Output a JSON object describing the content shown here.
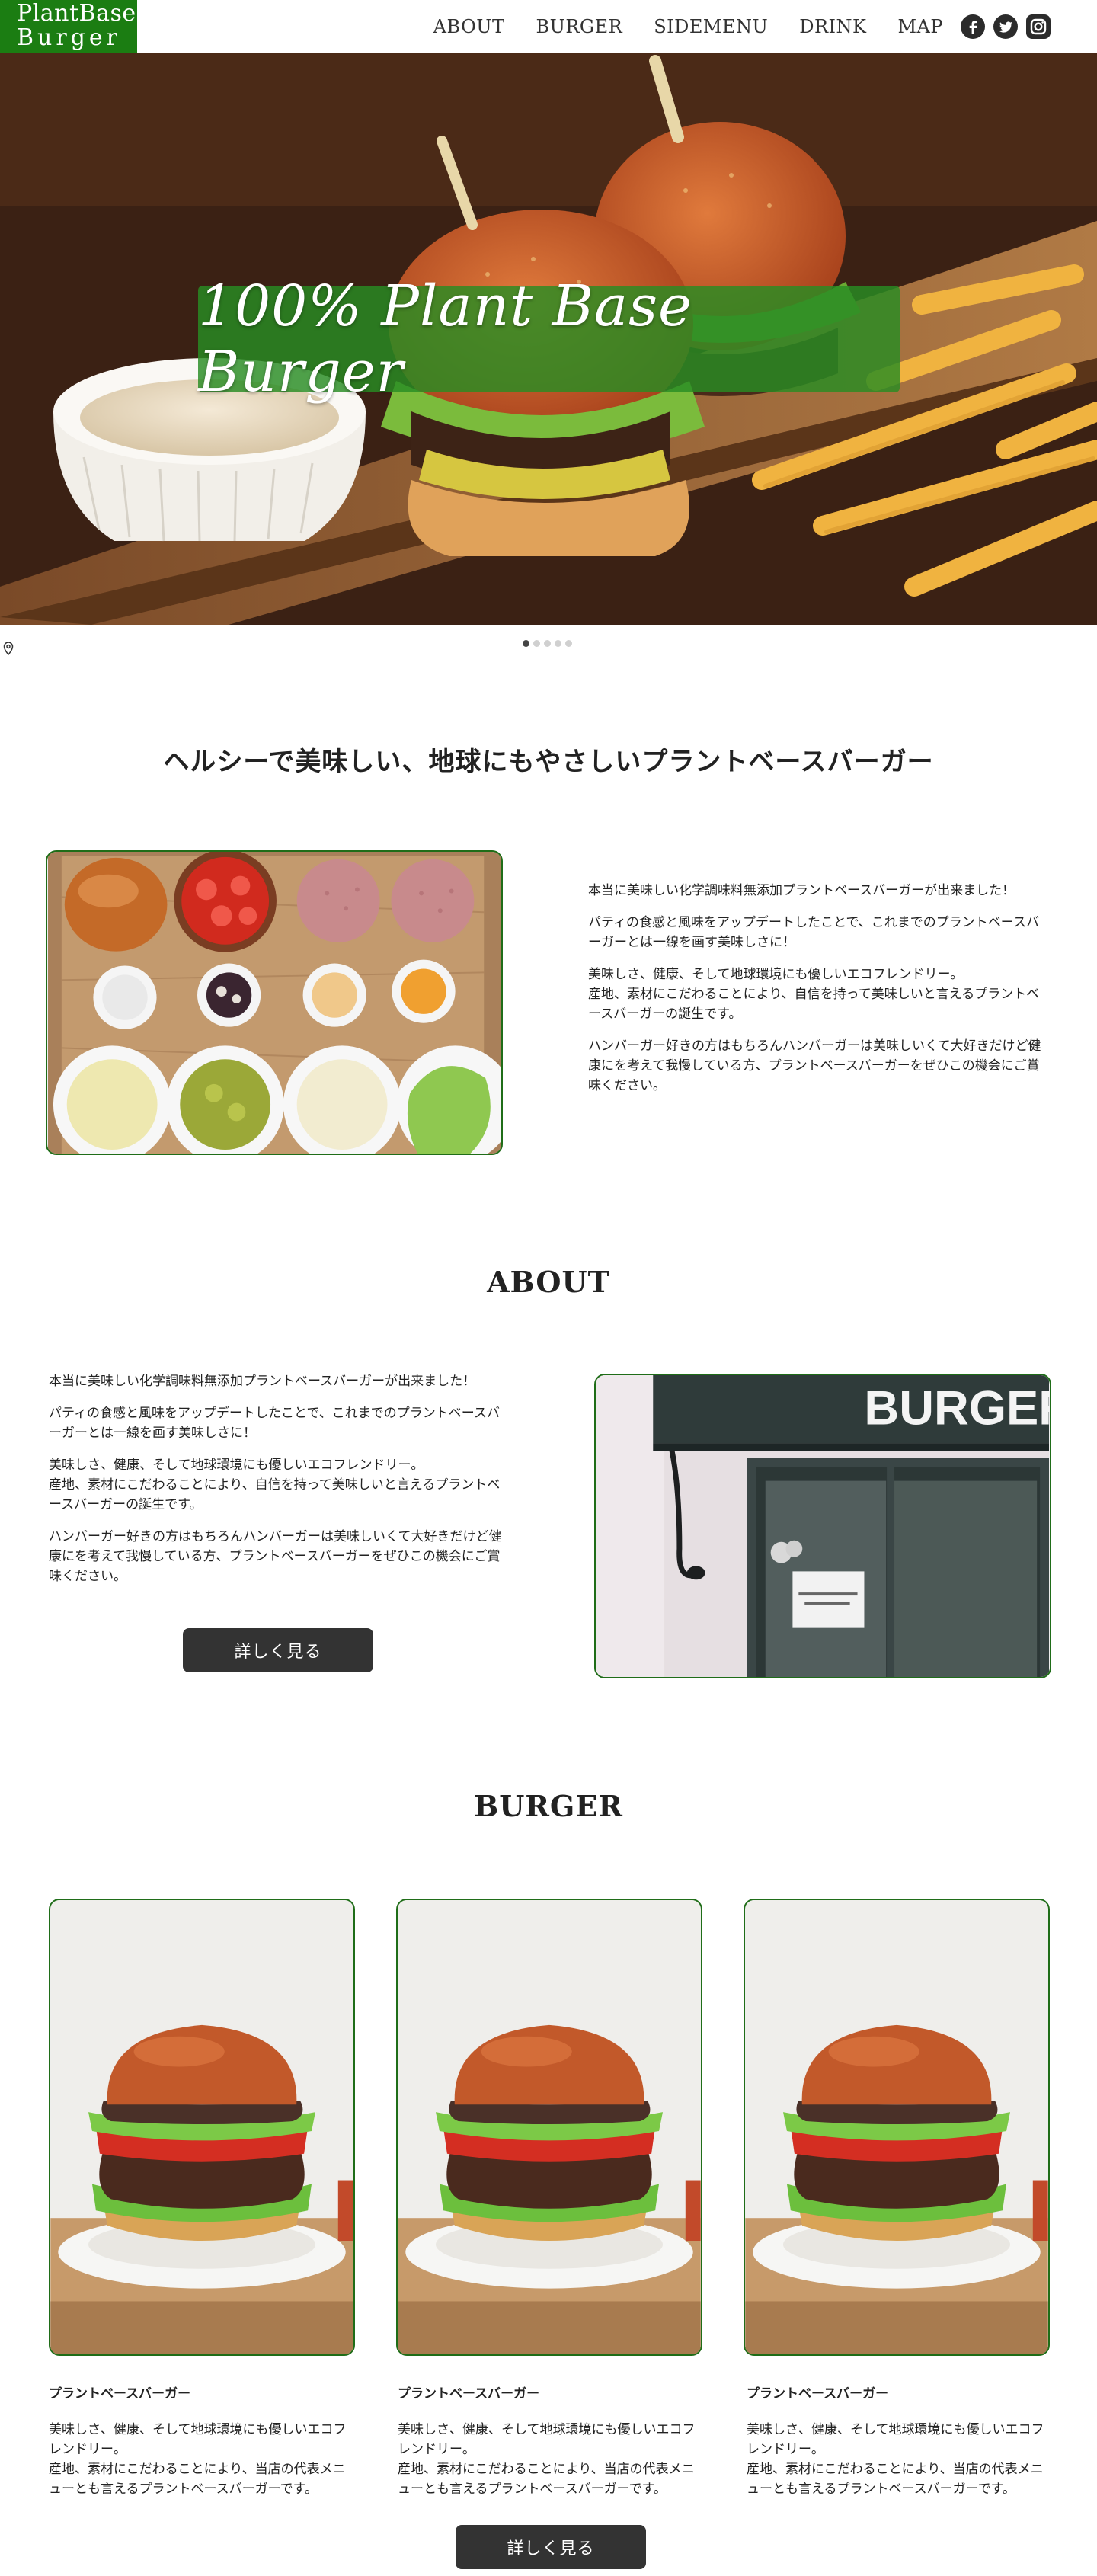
{
  "header": {
    "logo_line1": "PlantBase",
    "logo_line2": "Burger",
    "nav": [
      "ABOUT",
      "BURGER",
      "SIDEMENU",
      "DRINK",
      "MAP"
    ],
    "social": [
      "facebook-icon",
      "twitter-icon",
      "instagram-icon"
    ]
  },
  "hero": {
    "banner": "100% Plant Base Burger",
    "slides": 5,
    "active_slide": 1
  },
  "intro": {
    "tagline": "ヘルシーで美味しい、地球にもやさしいプラントベースバーガー",
    "paragraphs": [
      "本当に美味しい化学調味料無添加プラントベースバーガーが出来ました！",
      "パティの食感と風味をアップデートしたことで、これまでのプラントベースバーガーとは一線を画す美味しさに！",
      "美味しさ、健康、そして地球環境にも優しいエコフレンドリー。\n産地、素材にこだわることにより、自信を持って美味しいと言えるプラントベースバーガーの誕生です。",
      "ハンバーガー好きの方はもちろんハンバーガーは美味しいくて大好きだけど健康にを考えて我慢している方、プラントベースバーガーをぜひこの機会にご賞味ください。"
    ]
  },
  "about": {
    "title": "ABOUT",
    "paragraphs": [
      "本当に美味しい化学調味料無添加プラントベースバーガーが出来ました！",
      "パティの食感と風味をアップデートしたことで、これまでのプラントベースバーガーとは一線を画す美味しさに！",
      "美味しさ、健康、そして地球環境にも優しいエコフレンドリー。\n産地、素材にこだわることにより、自信を持って美味しいと言えるプラントベースバーガーの誕生です。",
      "ハンバーガー好きの方はもちろんハンバーガーは美味しいくて大好きだけど健康にを考えて我慢している方、プラントベースバーガーをぜひこの機会にご賞味ください。"
    ],
    "button": "詳しく見る",
    "sign_text": "BURGER"
  },
  "burger": {
    "title": "BURGER",
    "cards": [
      {
        "name": "プラントベースバーガー",
        "desc": "美味しさ、健康、そして地球環境にも優しいエコフレンドリー。\n産地、素材にこだわることにより、当店の代表メニューとも言えるプラントベースバーガーです。"
      },
      {
        "name": "プラントベースバーガー",
        "desc": "美味しさ、健康、そして地球環境にも優しいエコフレンドリー。\n産地、素材にこだわることにより、当店の代表メニューとも言えるプラントベースバーガーです。"
      },
      {
        "name": "プラントベースバーガー",
        "desc": "美味しさ、健康、そして地球環境にも優しいエコフレンドリー。\n産地、素材にこだわることにより、当店の代表メニューとも言えるプラントベースバーガーです。"
      }
    ],
    "button": "詳しく見る"
  },
  "colors": {
    "brand_green": "#1b7d12",
    "button_dark": "#333333",
    "frame_green": "#1f6d18"
  }
}
